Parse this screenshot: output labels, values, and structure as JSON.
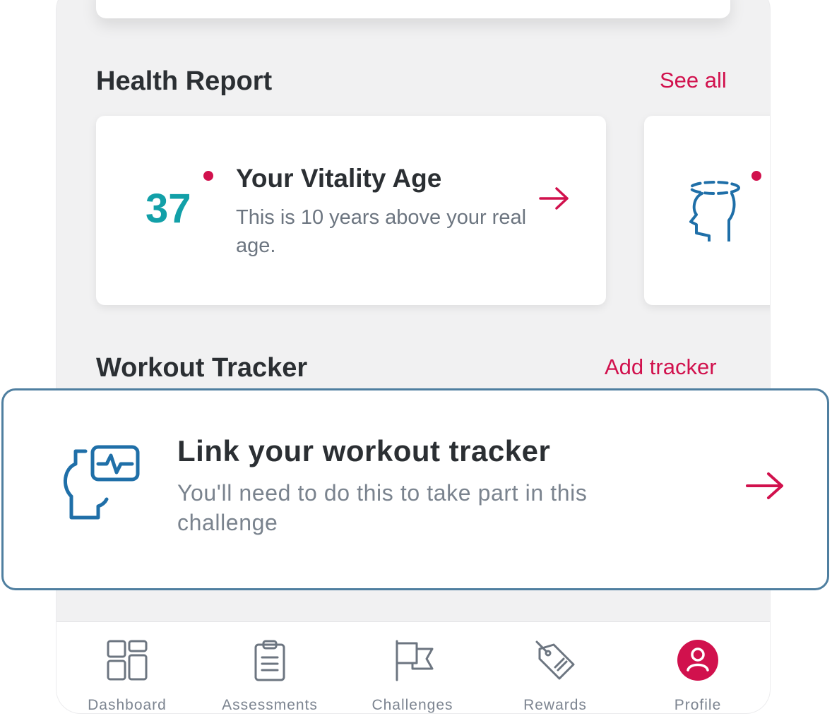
{
  "health_report": {
    "title": "Health Report",
    "see_all": "See all",
    "card": {
      "age_value": "37",
      "title": "Your Vitality Age",
      "description": "This is 10 years above your real age."
    }
  },
  "workout_tracker": {
    "title": "Workout Tracker",
    "add_tracker": "Add tracker"
  },
  "link_tracker": {
    "title": "Link your workout tracker",
    "description": "You'll need to do this to take part in this challenge"
  },
  "nav": {
    "items": [
      {
        "label": "Dashboard",
        "icon": "dashboard-icon"
      },
      {
        "label": "Assessments",
        "icon": "clipboard-icon"
      },
      {
        "label": "Challenges",
        "icon": "flag-icon"
      },
      {
        "label": "Rewards",
        "icon": "tag-icon"
      },
      {
        "label": "Profile",
        "icon": "profile-icon"
      }
    ]
  },
  "colors": {
    "accent": "#d1114d",
    "teal": "#12a0a8",
    "icon_blue": "#1f6fa8",
    "highlight_border": "#4f7fa0"
  }
}
